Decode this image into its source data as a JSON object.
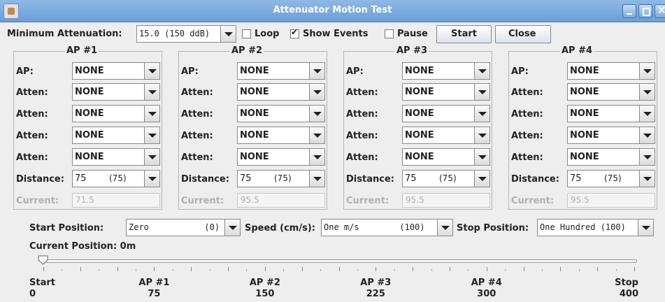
{
  "window": {
    "title": "Attenuator Motion Test"
  },
  "toolbar": {
    "min_atten_label": "Minimum Attenuation:",
    "min_atten_value": "15.0 (150 ddB)",
    "loop_label": "Loop",
    "show_events_label": "Show Events",
    "pause_label": "Pause",
    "start_label": "Start",
    "close_label": "Close",
    "loop_checked": false,
    "show_events_checked": true,
    "pause_checked": false
  },
  "groups": [
    {
      "title": "AP #1",
      "ap_label": "AP:",
      "ap_value": "NONE",
      "atten_label": "Atten:",
      "atten_values": [
        "NONE",
        "NONE",
        "NONE",
        "NONE"
      ],
      "distance_label": "Distance:",
      "distance_value": "75",
      "distance_code": "(75)",
      "current_label": "Current:",
      "current_value": "71.5"
    },
    {
      "title": "AP #2",
      "ap_label": "AP:",
      "ap_value": "NONE",
      "atten_label": "Atten:",
      "atten_values": [
        "NONE",
        "NONE",
        "NONE",
        "NONE"
      ],
      "distance_label": "Distance:",
      "distance_value": "75",
      "distance_code": "(75)",
      "current_label": "Current:",
      "current_value": "95.5"
    },
    {
      "title": "AP #3",
      "ap_label": "AP:",
      "ap_value": "NONE",
      "atten_label": "Atten:",
      "atten_values": [
        "NONE",
        "NONE",
        "NONE",
        "NONE"
      ],
      "distance_label": "Distance:",
      "distance_value": "75",
      "distance_code": "(75)",
      "current_label": "Current:",
      "current_value": "95.5"
    },
    {
      "title": "AP #4",
      "ap_label": "AP:",
      "ap_value": "NONE",
      "atten_label": "Atten:",
      "atten_values": [
        "NONE",
        "NONE",
        "NONE",
        "NONE"
      ],
      "distance_label": "Distance:",
      "distance_value": "75",
      "distance_code": "(75)",
      "current_label": "Current:",
      "current_value": "95.5"
    }
  ],
  "motion": {
    "start_position_label": "Start Position:",
    "start_position_value": "Zero           (0)",
    "speed_label": "Speed (cm/s):",
    "speed_value": "One m/s        (100)",
    "stop_position_label": "Stop Position:",
    "stop_position_value": "One Hundred (100)",
    "current_position_label": "Current Position: 0m"
  },
  "slider": {
    "value": 0,
    "min": 0,
    "max": 400,
    "labels": [
      {
        "name": "Start",
        "value": "0"
      },
      {
        "name": "AP #1",
        "value": "75"
      },
      {
        "name": "AP #2",
        "value": "150"
      },
      {
        "name": "AP #3",
        "value": "225"
      },
      {
        "name": "AP #4",
        "value": "300"
      },
      {
        "name": "Stop",
        "value": "400"
      }
    ]
  }
}
